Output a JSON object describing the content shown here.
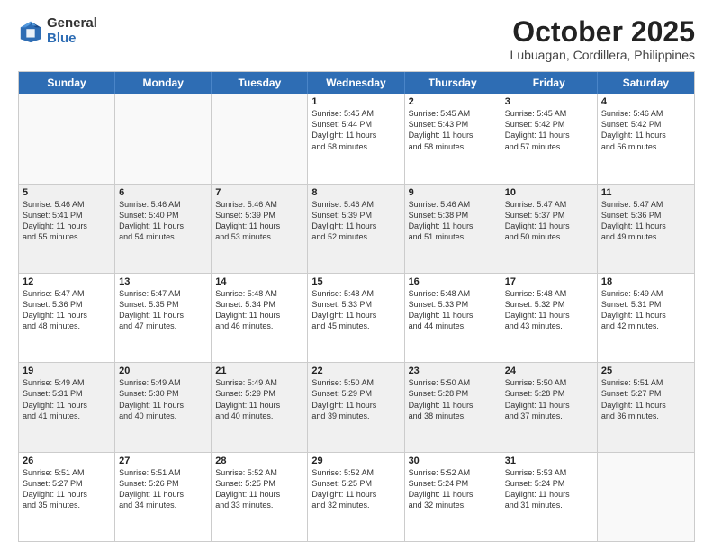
{
  "logo": {
    "general": "General",
    "blue": "Blue"
  },
  "title": "October 2025",
  "location": "Lubuagan, Cordillera, Philippines",
  "days_of_week": [
    "Sunday",
    "Monday",
    "Tuesday",
    "Wednesday",
    "Thursday",
    "Friday",
    "Saturday"
  ],
  "weeks": [
    [
      {
        "day": "",
        "info": ""
      },
      {
        "day": "",
        "info": ""
      },
      {
        "day": "",
        "info": ""
      },
      {
        "day": "1",
        "info": "Sunrise: 5:45 AM\nSunset: 5:44 PM\nDaylight: 11 hours\nand 58 minutes."
      },
      {
        "day": "2",
        "info": "Sunrise: 5:45 AM\nSunset: 5:43 PM\nDaylight: 11 hours\nand 58 minutes."
      },
      {
        "day": "3",
        "info": "Sunrise: 5:45 AM\nSunset: 5:42 PM\nDaylight: 11 hours\nand 57 minutes."
      },
      {
        "day": "4",
        "info": "Sunrise: 5:46 AM\nSunset: 5:42 PM\nDaylight: 11 hours\nand 56 minutes."
      }
    ],
    [
      {
        "day": "5",
        "info": "Sunrise: 5:46 AM\nSunset: 5:41 PM\nDaylight: 11 hours\nand 55 minutes."
      },
      {
        "day": "6",
        "info": "Sunrise: 5:46 AM\nSunset: 5:40 PM\nDaylight: 11 hours\nand 54 minutes."
      },
      {
        "day": "7",
        "info": "Sunrise: 5:46 AM\nSunset: 5:39 PM\nDaylight: 11 hours\nand 53 minutes."
      },
      {
        "day": "8",
        "info": "Sunrise: 5:46 AM\nSunset: 5:39 PM\nDaylight: 11 hours\nand 52 minutes."
      },
      {
        "day": "9",
        "info": "Sunrise: 5:46 AM\nSunset: 5:38 PM\nDaylight: 11 hours\nand 51 minutes."
      },
      {
        "day": "10",
        "info": "Sunrise: 5:47 AM\nSunset: 5:37 PM\nDaylight: 11 hours\nand 50 minutes."
      },
      {
        "day": "11",
        "info": "Sunrise: 5:47 AM\nSunset: 5:36 PM\nDaylight: 11 hours\nand 49 minutes."
      }
    ],
    [
      {
        "day": "12",
        "info": "Sunrise: 5:47 AM\nSunset: 5:36 PM\nDaylight: 11 hours\nand 48 minutes."
      },
      {
        "day": "13",
        "info": "Sunrise: 5:47 AM\nSunset: 5:35 PM\nDaylight: 11 hours\nand 47 minutes."
      },
      {
        "day": "14",
        "info": "Sunrise: 5:48 AM\nSunset: 5:34 PM\nDaylight: 11 hours\nand 46 minutes."
      },
      {
        "day": "15",
        "info": "Sunrise: 5:48 AM\nSunset: 5:33 PM\nDaylight: 11 hours\nand 45 minutes."
      },
      {
        "day": "16",
        "info": "Sunrise: 5:48 AM\nSunset: 5:33 PM\nDaylight: 11 hours\nand 44 minutes."
      },
      {
        "day": "17",
        "info": "Sunrise: 5:48 AM\nSunset: 5:32 PM\nDaylight: 11 hours\nand 43 minutes."
      },
      {
        "day": "18",
        "info": "Sunrise: 5:49 AM\nSunset: 5:31 PM\nDaylight: 11 hours\nand 42 minutes."
      }
    ],
    [
      {
        "day": "19",
        "info": "Sunrise: 5:49 AM\nSunset: 5:31 PM\nDaylight: 11 hours\nand 41 minutes."
      },
      {
        "day": "20",
        "info": "Sunrise: 5:49 AM\nSunset: 5:30 PM\nDaylight: 11 hours\nand 40 minutes."
      },
      {
        "day": "21",
        "info": "Sunrise: 5:49 AM\nSunset: 5:29 PM\nDaylight: 11 hours\nand 40 minutes."
      },
      {
        "day": "22",
        "info": "Sunrise: 5:50 AM\nSunset: 5:29 PM\nDaylight: 11 hours\nand 39 minutes."
      },
      {
        "day": "23",
        "info": "Sunrise: 5:50 AM\nSunset: 5:28 PM\nDaylight: 11 hours\nand 38 minutes."
      },
      {
        "day": "24",
        "info": "Sunrise: 5:50 AM\nSunset: 5:28 PM\nDaylight: 11 hours\nand 37 minutes."
      },
      {
        "day": "25",
        "info": "Sunrise: 5:51 AM\nSunset: 5:27 PM\nDaylight: 11 hours\nand 36 minutes."
      }
    ],
    [
      {
        "day": "26",
        "info": "Sunrise: 5:51 AM\nSunset: 5:27 PM\nDaylight: 11 hours\nand 35 minutes."
      },
      {
        "day": "27",
        "info": "Sunrise: 5:51 AM\nSunset: 5:26 PM\nDaylight: 11 hours\nand 34 minutes."
      },
      {
        "day": "28",
        "info": "Sunrise: 5:52 AM\nSunset: 5:25 PM\nDaylight: 11 hours\nand 33 minutes."
      },
      {
        "day": "29",
        "info": "Sunrise: 5:52 AM\nSunset: 5:25 PM\nDaylight: 11 hours\nand 32 minutes."
      },
      {
        "day": "30",
        "info": "Sunrise: 5:52 AM\nSunset: 5:24 PM\nDaylight: 11 hours\nand 32 minutes."
      },
      {
        "day": "31",
        "info": "Sunrise: 5:53 AM\nSunset: 5:24 PM\nDaylight: 11 hours\nand 31 minutes."
      },
      {
        "day": "",
        "info": ""
      }
    ]
  ]
}
